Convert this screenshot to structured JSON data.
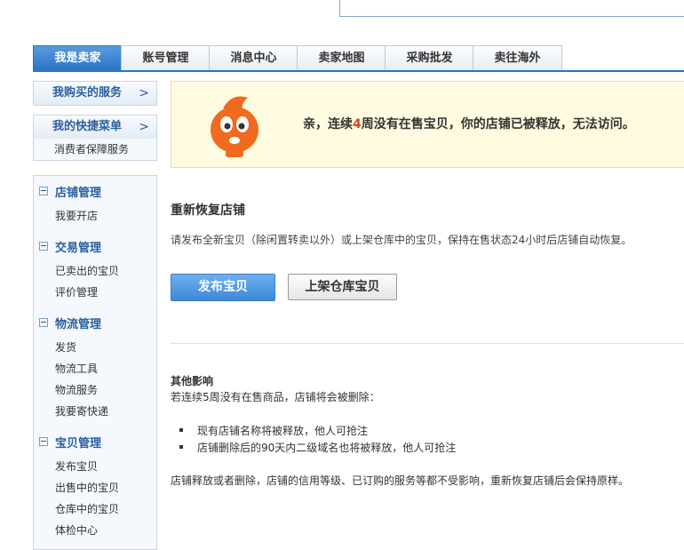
{
  "tabs": [
    "我是卖家",
    "账号管理",
    "消息中心",
    "卖家地图",
    "采购批发",
    "卖往海外"
  ],
  "side": {
    "purchased_services": "我购买的服务",
    "quick_menu": "我的快捷菜单",
    "quick_menu_item": "消费者保障服务",
    "arrow": ">"
  },
  "menu": {
    "store_mgmt": "店铺管理",
    "store_items": [
      "我要开店"
    ],
    "trade_mgmt": "交易管理",
    "trade_items": [
      "已卖出的宝贝",
      "评价管理"
    ],
    "logistics_mgmt": "物流管理",
    "logistics_items": [
      "发货",
      "物流工具",
      "物流服务",
      "我要寄快递"
    ],
    "items_mgmt": "宝贝管理",
    "items_items": [
      "发布宝贝",
      "出售中的宝贝",
      "仓库中的宝贝",
      "体检中心"
    ]
  },
  "notice": {
    "pre": "亲，连续",
    "num": "4",
    "post": "周没有在售宝贝，你的店铺已被释放，无法访问。"
  },
  "restore": {
    "title": "重新恢复店铺",
    "desc": "请发布全新宝贝（除闲置转卖以外）或上架仓库中的宝贝，保持在售状态24小时后店铺自动恢复。",
    "publish_btn": "发布宝贝",
    "shelve_btn": "上架仓库宝贝"
  },
  "other": {
    "title": "其他影响",
    "line": "若连续5周没有在售商品，店铺将会被删除：",
    "bullets": [
      "现有店铺名称将被释放，他人可抢注",
      "店铺删除后的90天内二级域名也将被释放，他人可抢注"
    ],
    "footer": "店铺释放或者删除，店铺的信用等级、已订购的服务等都不受影响，重新恢复店铺后会保持原样。"
  },
  "colors": {
    "accent": "#2a74c6",
    "warn": "#e0451c",
    "notice_bg": "#fffbe0"
  }
}
